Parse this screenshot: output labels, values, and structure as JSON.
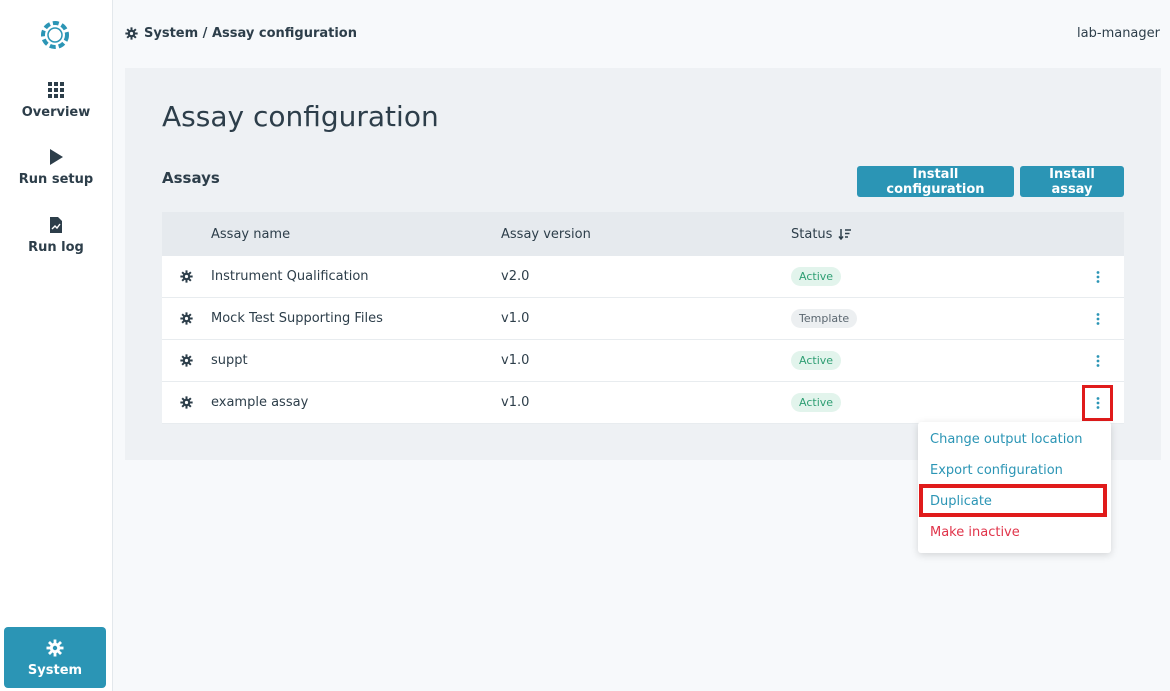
{
  "sidebar": {
    "logo_icon": "aperture-logo-icon",
    "items": [
      {
        "label": "Overview",
        "icon": "grid-icon"
      },
      {
        "label": "Run setup",
        "icon": "play-icon"
      },
      {
        "label": "Run log",
        "icon": "document-chart-icon"
      }
    ],
    "system": {
      "label": "System",
      "icon": "gear-icon"
    }
  },
  "header": {
    "breadcrumb": "System / Assay configuration",
    "user": "lab-manager"
  },
  "main": {
    "title": "Assay configuration",
    "section_title": "Assays",
    "buttons": {
      "install_configuration": "Install configuration",
      "install_assay": "Install assay"
    },
    "table": {
      "columns": [
        "Assay name",
        "Assay version",
        "Status"
      ],
      "rows": [
        {
          "name": "Instrument Qualification",
          "version": "v2.0",
          "status": "Active"
        },
        {
          "name": "Mock Test Supporting Files",
          "version": "v1.0",
          "status": "Template"
        },
        {
          "name": "suppt",
          "version": "v1.0",
          "status": "Active"
        },
        {
          "name": "example assay",
          "version": "v1.0",
          "status": "Active"
        }
      ]
    }
  },
  "dropdown": {
    "items": [
      "Change output location",
      "Export configuration",
      "Duplicate",
      "Make inactive"
    ]
  },
  "colors": {
    "accent": "#2b95b5",
    "active_badge": "#2e9e73",
    "danger": "#e0344a",
    "highlight": "#e01b1b"
  }
}
